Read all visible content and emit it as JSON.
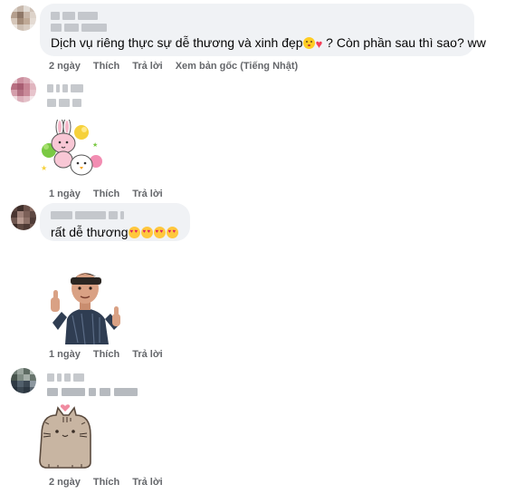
{
  "comments": [
    {
      "text_before": "Dịch vụ riêng thực sự dễ thương và xinh đẹp",
      "text_after": "? Còn phần sau thì sao? ww",
      "emojis": [
        "kissing-face-emoji",
        "heart-emoji"
      ],
      "time": "2 ngày",
      "like": "Thích",
      "reply": "Trả lời",
      "see_original": "Xem bản gốc (Tiếng Nhật)"
    },
    {
      "sticker": "bunny-cheerleader-sticker",
      "time": "1 ngày",
      "like": "Thích",
      "reply": "Trả lời"
    },
    {
      "text": "rất dễ thương",
      "emojis": [
        "heart-eyes-emoji",
        "heart-eyes-emoji",
        "heart-eyes-emoji",
        "heart-eyes-emoji"
      ],
      "sticker": "avatar-thumbs-up-sticker",
      "time": "1 ngày",
      "like": "Thích",
      "reply": "Trả lời"
    },
    {
      "sticker": "pusheen-cat-heart-sticker",
      "time": "2 ngày",
      "like": "Thích",
      "reply": "Trả lời"
    }
  ],
  "colors": {
    "bubble": "#f0f2f5",
    "meta_text": "#65676b",
    "body_text": "#050505"
  }
}
